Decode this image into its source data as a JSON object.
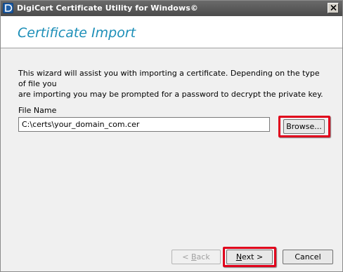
{
  "window": {
    "title": "DigiCert Certificate Utility for Windows©"
  },
  "header": {
    "title": "Certificate Import"
  },
  "intro": {
    "line1": "This wizard will assist you with importing a certificate.  Depending on the type of file you",
    "line2": "are importing you may be prompted for a password to decrypt the private key."
  },
  "file": {
    "label": "File Name",
    "value": "C:\\certs\\your_domain_com.cer"
  },
  "buttons": {
    "browse": "Browse...",
    "back_prefix": "< ",
    "back_mnemonic": "B",
    "back_rest": "ack",
    "next_mnemonic": "N",
    "next_rest": "ext >",
    "cancel": "Cancel"
  },
  "colors": {
    "header_title": "#1d8fb8",
    "highlight": "#e0001b",
    "titlebar": "#5a5a5a"
  },
  "icons": [
    "app-icon",
    "close-icon"
  ]
}
